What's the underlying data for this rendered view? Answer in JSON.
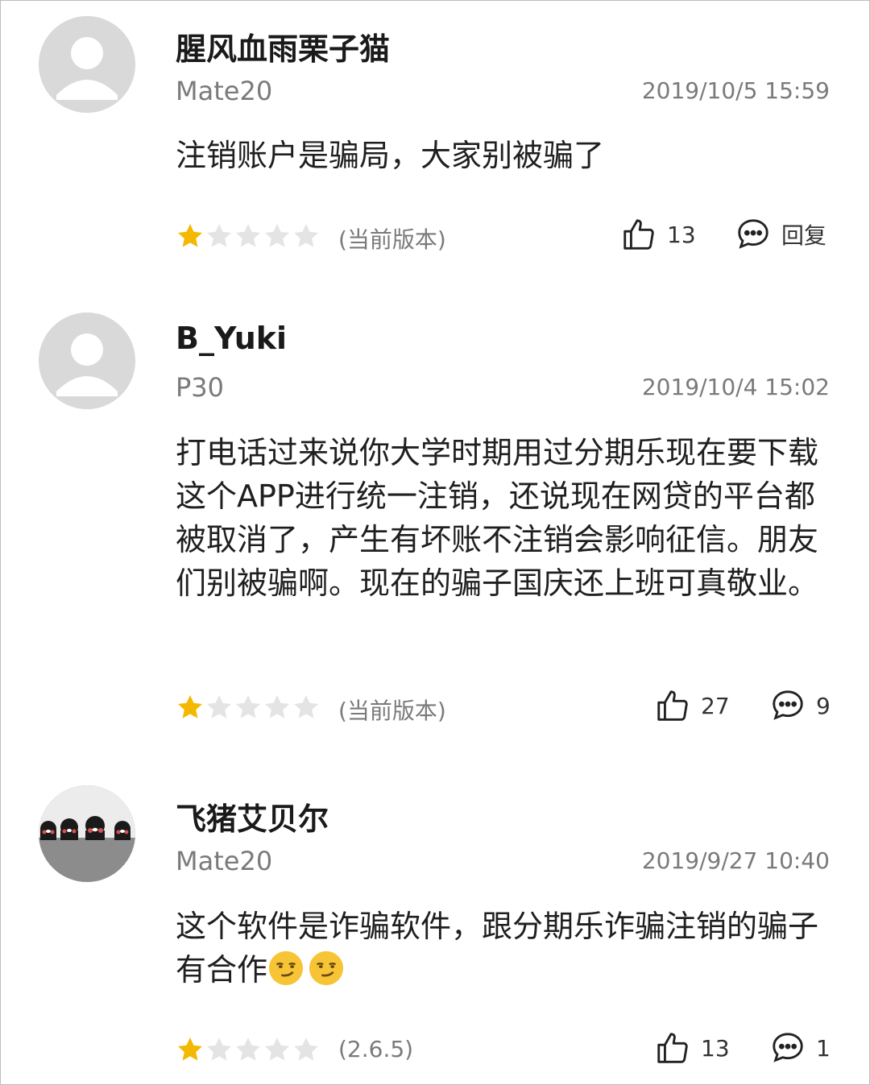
{
  "colors": {
    "star_filled": "#f5b800",
    "star_empty": "#e4e4e4",
    "text_primary": "#1a1a1a",
    "text_secondary": "#7a7a7a",
    "avatar_bg": "#d9d9d9"
  },
  "reviews": [
    {
      "username": "腥风血雨栗子猫",
      "device": "Mate20",
      "date": "2019/10/5 15:59",
      "content": "注销账户是骗局，大家别被骗了",
      "rating": 1,
      "rating_max": 5,
      "version": "(当前版本)",
      "likes": "13",
      "reply_label": "回复",
      "avatar_icon": "default-user-icon"
    },
    {
      "username": "B_Yuki",
      "device": "P30",
      "date": "2019/10/4 15:02",
      "content": "打电话过来说你大学时期用过分期乐现在要下载这个APP进行统一注销，还说现在网贷的平台都被取消了，产生有坏账不注销会影响征信。朋友们别被骗啊。现在的骗子国庆还上班可真敬业。",
      "rating": 1,
      "rating_max": 5,
      "version": "(当前版本)",
      "likes": "27",
      "reply_label": "9",
      "avatar_icon": "default-user-icon"
    },
    {
      "username": "飞猪艾贝尔",
      "device": "Mate20",
      "date": "2019/9/27 10:40",
      "content": "这个软件是诈骗软件，跟分期乐诈骗注销的骗子有合作",
      "emojis": [
        "smirk-emoji",
        "smirk-emoji"
      ],
      "rating": 1,
      "rating_max": 5,
      "version": "(2.6.5)",
      "likes": "13",
      "reply_label": "1",
      "avatar_icon": "bear-group-avatar"
    }
  ]
}
